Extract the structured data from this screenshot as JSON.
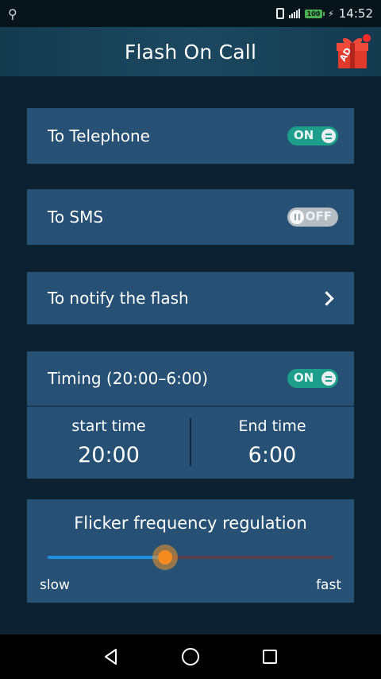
{
  "status_bar": {
    "time": "14:52",
    "battery": "100"
  },
  "header": {
    "title": "Flash On Call",
    "ad_badge": "AD"
  },
  "settings": {
    "telephone": {
      "label": "To Telephone",
      "toggle": "ON",
      "enabled": true
    },
    "sms": {
      "label": "To SMS",
      "toggle": "OFF",
      "enabled": false
    },
    "notify": {
      "label": "To notify the flash"
    },
    "timing": {
      "label": "Timing (20:00–6:00)",
      "toggle": "ON",
      "enabled": true,
      "start_label": "start time",
      "start_value": "20:00",
      "end_label": "End time",
      "end_value": "6:00"
    },
    "flicker": {
      "title": "Flicker frequency regulation",
      "slow_label": "slow",
      "fast_label": "fast",
      "level": 0.41
    }
  },
  "colors": {
    "background": "#0c2230",
    "card": "#275075",
    "toggle_on": "#1c9e8a",
    "toggle_off": "#b7bec3",
    "slider_fill": "#1f8fe0",
    "slider_thumb": "#f58a1e"
  },
  "nav": {
    "back_icon": "back-triangle-icon",
    "home_icon": "home-circle-icon",
    "recents_icon": "recents-square-icon"
  }
}
